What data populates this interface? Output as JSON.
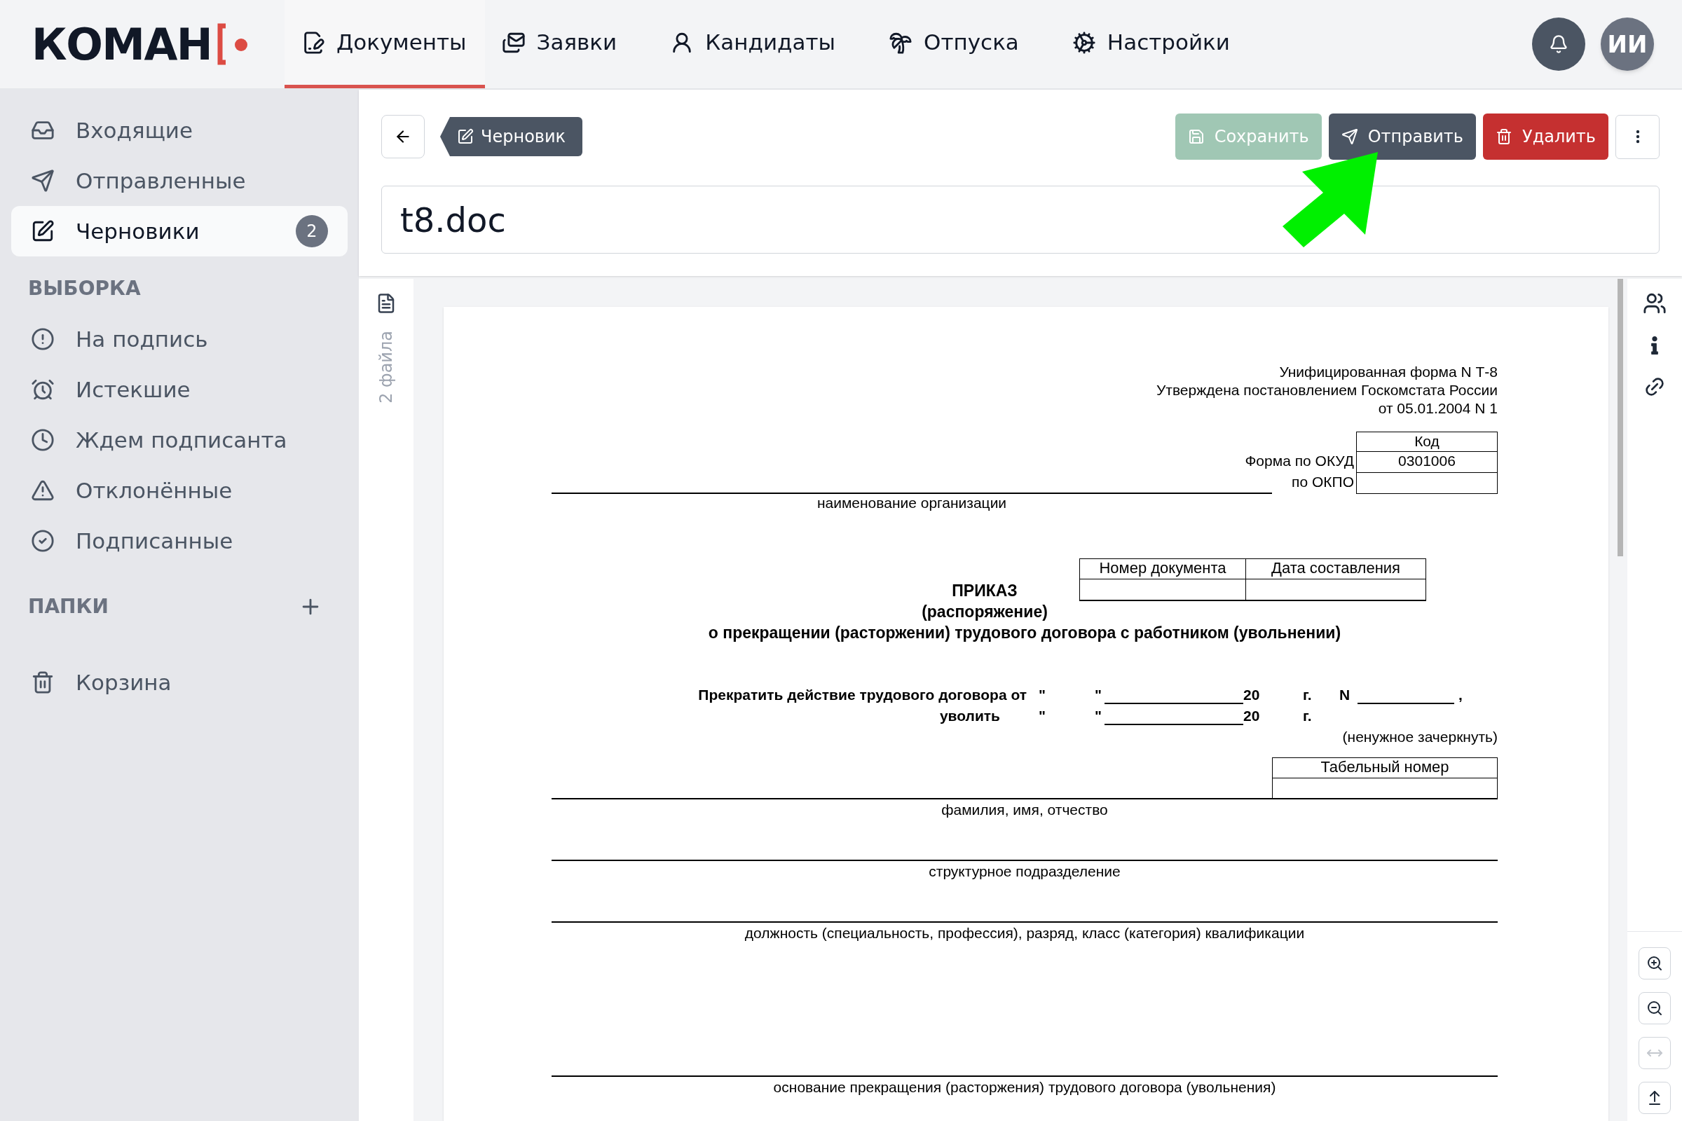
{
  "brand": {
    "logo": "КОМАН"
  },
  "nav": [
    {
      "label": "Документы",
      "selected": true
    },
    {
      "label": "Заявки",
      "selected": false
    },
    {
      "label": "Кандидаты",
      "selected": false
    },
    {
      "label": "Отпуска",
      "selected": false
    },
    {
      "label": "Настройки",
      "selected": false
    }
  ],
  "user": {
    "initials": "ИИ"
  },
  "sidebar": {
    "main_items": [
      {
        "label": "Входящие",
        "selected": false
      },
      {
        "label": "Отправленные",
        "selected": false
      },
      {
        "label": "Черновики",
        "selected": true,
        "badge": "2"
      }
    ],
    "filter_title": "ВЫБОРКА",
    "filter_items": [
      {
        "label": "На подпись",
        "selected": false
      },
      {
        "label": "Истекшие",
        "selected": false
      },
      {
        "label": "Ждем подписанта",
        "selected": false
      },
      {
        "label": "Отклонённые",
        "selected": false
      },
      {
        "label": "Подписанные",
        "selected": false
      }
    ],
    "folders_title": "ПАПКИ",
    "bottom_items": [
      {
        "label": "Корзина",
        "selected": false
      }
    ]
  },
  "toolbar": {
    "status": "Черновик",
    "buttons": [
      {
        "kind": "save",
        "label": "Сохранить",
        "disabled": true
      },
      {
        "kind": "send",
        "label": "Отправить",
        "disabled": false
      },
      {
        "kind": "delete",
        "label": "Удалить",
        "disabled": false
      }
    ]
  },
  "title_field": {
    "value": "t8.doc"
  },
  "files_strip": {
    "label": "2 файла"
  },
  "document": {
    "form_header": [
      "Унифицированная форма N Т-8",
      "Утверждена постановлением Госкомстата России",
      "от 05.01.2004 N 1"
    ],
    "codes": {
      "heading": "Код",
      "rows": [
        {
          "label": "Форма по ОКУД",
          "value": "0301006"
        },
        {
          "label": "по ОКПО"
        }
      ]
    },
    "org_caption": "наименование организации",
    "doc_table": {
      "columns": [
        "Номер документа",
        "Дата составления"
      ]
    },
    "title": "ПРИКАЗ",
    "subtitle": "(распоряжение)",
    "heading": "о прекращении (расторжении) трудового договора с работником (увольнении)",
    "date_rows": [
      {
        "label": "Прекратить действие трудового договора от",
        "open_quote": "\"",
        "close_quote": "\"",
        "year": "20",
        "year_suffix": "г.",
        "number_label": "N",
        "trailing": ","
      },
      {
        "label": "уволить",
        "open_quote": "\"",
        "close_quote": "\"",
        "year": "20",
        "year_suffix": "г."
      }
    ],
    "strike_note": "(ненужное зачеркнуть)",
    "personnel_table": {
      "column": "Табельный номер"
    },
    "captions": [
      "фамилия, имя, отчество",
      "структурное подразделение",
      "должность (специальность, профессия), разряд, класс (категория) квалификации",
      "основание прекращения (расторжения) трудового договора (увольнения)"
    ]
  },
  "zoom_controls": [
    {
      "kind": "zoom-in",
      "disabled": false
    },
    {
      "kind": "zoom-out",
      "disabled": false
    },
    {
      "kind": "fit-width",
      "disabled": true
    },
    {
      "kind": "fit-height",
      "disabled": false
    }
  ]
}
